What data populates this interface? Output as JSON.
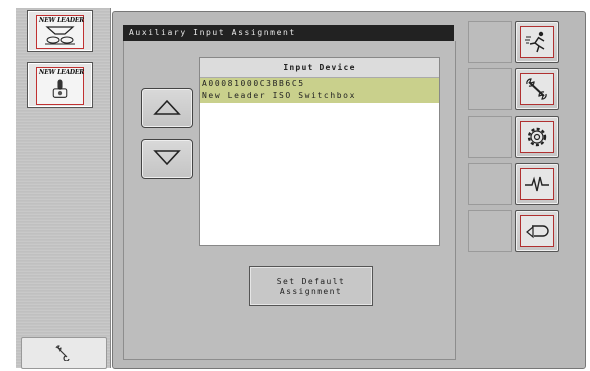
{
  "left_panel": {
    "tabs": [
      {
        "brand": "NEW LEADER",
        "icon": "spinner-spreader-icon"
      },
      {
        "brand": "NEW LEADER",
        "icon": "joystick-icon"
      }
    ],
    "bottom_button_icon": "wrench-icon"
  },
  "window": {
    "title": "Auxiliary Input Assignment"
  },
  "list": {
    "header": "Input Device",
    "items": [
      "A00081000C3BB6C5",
      "New Leader ISO Switchbox"
    ]
  },
  "default_button": {
    "line1": "Set Default",
    "line2": "Assignment"
  },
  "nav_buttons": {
    "up_icon": "up-arrow-icon",
    "down_icon": "down-arrow-icon"
  },
  "softkeys": [
    {
      "name": "runner-icon"
    },
    {
      "name": "wrench-icon"
    },
    {
      "name": "gear-icon"
    },
    {
      "name": "pulse-icon"
    },
    {
      "name": "back-arrow-icon"
    }
  ],
  "colors": {
    "title_bar": "#222222",
    "selected_row": "#c9d08c",
    "softkey_border": "#b03030"
  }
}
